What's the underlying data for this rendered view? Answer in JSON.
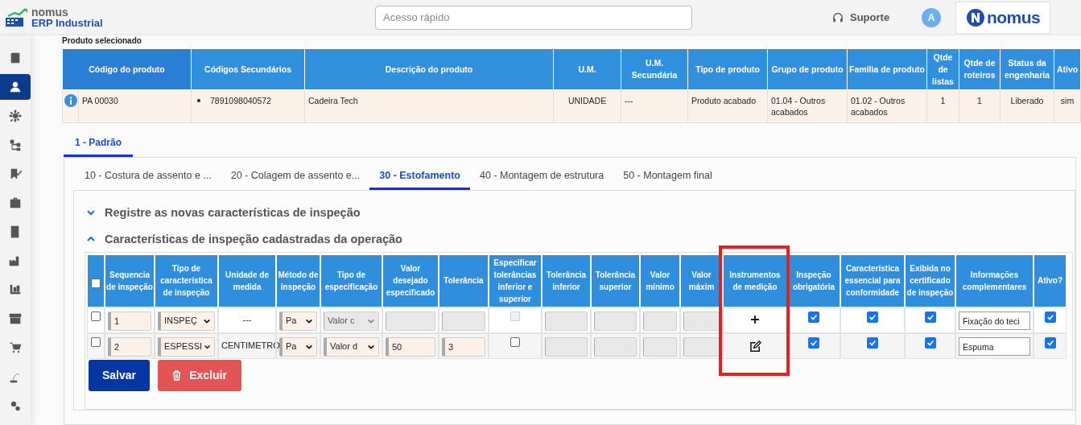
{
  "header": {
    "logo": {
      "line1": "nomus",
      "line2": "ERP Industrial"
    },
    "search": {
      "placeholder": "Acesso rápido"
    },
    "support": "Suporte",
    "avatar": "A",
    "brand": "nomus"
  },
  "sidebar": {
    "items": [
      {
        "selected": false
      },
      {
        "selected": true
      },
      {
        "selected": false
      },
      {
        "selected": false
      },
      {
        "selected": false
      },
      {
        "selected": false
      },
      {
        "selected": false
      },
      {
        "selected": false
      },
      {
        "selected": false
      },
      {
        "selected": false
      },
      {
        "selected": false
      },
      {
        "selected": false
      },
      {
        "selected": false
      }
    ]
  },
  "product": {
    "label": "Produto selecionado",
    "columns": [
      "Código do produto",
      "Códigos Secundários",
      "Descrição do produto",
      "U.M.",
      "U.M. Secundária",
      "Tipo de produto",
      "Grupo de produto",
      "Familia de produto",
      "Qtde de listas",
      "Qtde de roteiros",
      "Status da engenharia",
      "Ativo"
    ],
    "row": {
      "code": "PA 00030",
      "secondary_codes": [
        "7891098040572"
      ],
      "cells": [
        "Cadeira Tech",
        "UNIDADE",
        "---",
        "Produto acabado",
        "01.04 - Outros acabados",
        "01.02 - Outros acabados",
        "1",
        "1",
        "Liberado",
        "sim"
      ]
    }
  },
  "route_tabs": [
    {
      "label": "1 - Padrão",
      "selected": true
    }
  ],
  "operation_tabs": [
    {
      "label": "10 - Costura de assento e ...",
      "selected": false
    },
    {
      "label": "20 - Colagem de assento e...",
      "selected": false
    },
    {
      "label": "30 - Estofamento",
      "selected": true
    },
    {
      "label": "40 - Montagem de estrutura",
      "selected": false
    },
    {
      "label": "50 - Montagem final",
      "selected": false
    }
  ],
  "sections": [
    {
      "title": "Registre as novas características de inspeção",
      "expanded": false
    },
    {
      "title": "Características de inspeção cadastradas da operação",
      "expanded": true
    }
  ],
  "inspection_table": {
    "select_all": false,
    "columns": [
      "Sequencia de inspeção",
      "Tipo de característica de inspeção",
      "Unidade de medida",
      "Método de inspeção",
      "Tipo de especificação",
      "Valor desejado especificado",
      "Tolerância",
      "Especificar tolerâncias inferior e superior",
      "Tolerância inferior",
      "Tolerância superior",
      "Valor mínimo",
      "Valor máxim",
      "Instrumentos de medição",
      "Inspeção obrigatória",
      "Característica essencial para conformidade",
      "Exibida no certificado de inspeção",
      "Informações complementares",
      "Ativo?"
    ],
    "rows": [
      {
        "checked": false,
        "cells": [
          {
            "kind": "input",
            "value": "1",
            "disabled": false
          },
          {
            "kind": "select",
            "value": "INSPEÇ",
            "disabled": false
          },
          {
            "kind": "text",
            "value": "---"
          },
          {
            "kind": "select",
            "value": "Pa",
            "disabled": false
          },
          {
            "kind": "select",
            "value": "Valor c",
            "disabled": true
          },
          {
            "kind": "input",
            "disabled": true
          },
          {
            "kind": "input",
            "disabled": true
          },
          {
            "kind": "checkbox",
            "checked": false,
            "disabled": true
          },
          {
            "kind": "input",
            "disabled": true
          },
          {
            "kind": "input",
            "disabled": true
          },
          {
            "kind": "input",
            "disabled": true
          },
          {
            "kind": "input",
            "disabled": true
          },
          {
            "kind": "add"
          },
          {
            "kind": "checkbox",
            "checked": true,
            "disabled": false
          },
          {
            "kind": "checkbox",
            "checked": true,
            "disabled": false
          },
          {
            "kind": "checkbox",
            "checked": true,
            "disabled": false
          },
          {
            "kind": "note",
            "value": "Fixação do teci"
          },
          {
            "kind": "checkbox",
            "checked": true,
            "disabled": false
          }
        ]
      },
      {
        "checked": false,
        "cells": [
          {
            "kind": "input",
            "value": "2",
            "disabled": false
          },
          {
            "kind": "select",
            "value": "ESPESSI",
            "disabled": false
          },
          {
            "kind": "text",
            "value": "CENTIMETRO"
          },
          {
            "kind": "select",
            "value": "Pa",
            "disabled": false
          },
          {
            "kind": "select",
            "value": "Valor d",
            "disabled": false
          },
          {
            "kind": "input",
            "value": "50",
            "disabled": false
          },
          {
            "kind": "input",
            "value": "3",
            "disabled": false
          },
          {
            "kind": "checkbox",
            "checked": false,
            "disabled": false
          },
          {
            "kind": "input",
            "disabled": true
          },
          {
            "kind": "input",
            "disabled": true
          },
          {
            "kind": "input",
            "disabled": true
          },
          {
            "kind": "input",
            "disabled": true
          },
          {
            "kind": "edit"
          },
          {
            "kind": "checkbox",
            "checked": true,
            "disabled": false
          },
          {
            "kind": "checkbox",
            "checked": true,
            "disabled": false
          },
          {
            "kind": "checkbox",
            "checked": true,
            "disabled": false
          },
          {
            "kind": "note",
            "value": "Espuma"
          },
          {
            "kind": "checkbox",
            "checked": true,
            "disabled": false
          }
        ]
      }
    ]
  },
  "buttons": [
    {
      "label": "Salvar",
      "kind": "primary"
    },
    {
      "label": "Excluir",
      "kind": "danger"
    }
  ],
  "highlight": {
    "kind": "frame"
  }
}
